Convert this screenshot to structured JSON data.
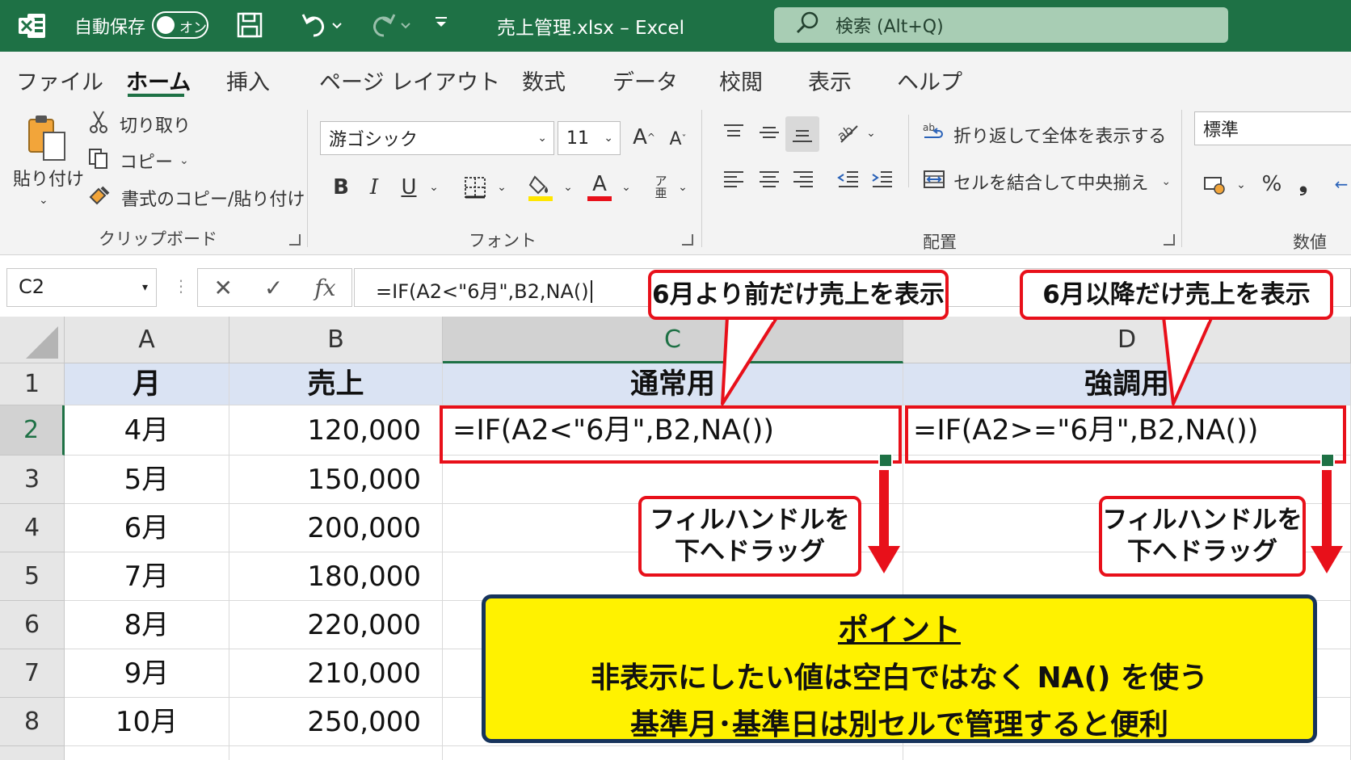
{
  "titlebar": {
    "autosave_label": "自動保存",
    "autosave_toggle": "オン",
    "doc_title": "売上管理.xlsx  –  Excel",
    "search_placeholder": "検索 (Alt+Q)"
  },
  "tabs": [
    "ファイル",
    "ホーム",
    "挿入",
    "ページ レイアウト",
    "数式",
    "データ",
    "校閲",
    "表示",
    "ヘルプ"
  ],
  "active_tab": "ホーム",
  "ribbon": {
    "clipboard": {
      "paste": "貼り付け",
      "cut": "切り取り",
      "copy": "コピー",
      "format_painter": "書式のコピー/貼り付け",
      "group_label": "クリップボード"
    },
    "font": {
      "font_name": "游ゴシック",
      "font_size": "11",
      "group_label": "フォント",
      "bold": "B",
      "italic": "I",
      "underline": "U",
      "font_color_letter": "A",
      "highlight_color": "#ffe600",
      "font_color": "#e8101a"
    },
    "alignment": {
      "wrap_text": "折り返して全体を表示する",
      "merge_center": "セルを結合して中央揃え",
      "group_label": "配置"
    },
    "number": {
      "format": "標準",
      "percent": "%",
      "comma": "❟",
      "group_label": "数値"
    }
  },
  "formula_bar": {
    "name_box": "C2",
    "fx": "fx",
    "formula": "=IF(A2<\"6月\",B2,NA()"
  },
  "grid": {
    "columns": [
      "A",
      "B",
      "C",
      "D"
    ],
    "row_numbers": [
      "1",
      "2",
      "3",
      "4",
      "5",
      "6",
      "7",
      "8"
    ],
    "header_row": [
      "月",
      "売上",
      "通常用",
      "強調用"
    ],
    "rows": [
      {
        "month": "4月",
        "sales": "120,000"
      },
      {
        "month": "5月",
        "sales": "150,000"
      },
      {
        "month": "6月",
        "sales": "200,000"
      },
      {
        "month": "7月",
        "sales": "180,000"
      },
      {
        "month": "8月",
        "sales": "220,000"
      },
      {
        "month": "9月",
        "sales": "210,000"
      },
      {
        "month": "10月",
        "sales": "250,000"
      }
    ],
    "c2_formula": "=IF(A2<\"6月\",B2,NA())",
    "d2_formula": "=IF(A2>=\"6月\",B2,NA())",
    "selected_cell": "C2"
  },
  "annotations": {
    "callout_c": "6月より前だけ売上を表示",
    "callout_d": "6月以降だけ売上を表示",
    "drag_line1": "フィルハンドルを",
    "drag_line2": "下へドラッグ",
    "point_title": "ポイント",
    "point_line1": "非表示にしたい値は空白ではなく NA() を使う",
    "point_line2": "基準月･基準日は別セルで管理すると便利",
    "accent_red": "#e8101a",
    "point_bg": "#fff200"
  },
  "colors": {
    "excel_green": "#1e7145",
    "header_fill": "#dae3f3"
  }
}
